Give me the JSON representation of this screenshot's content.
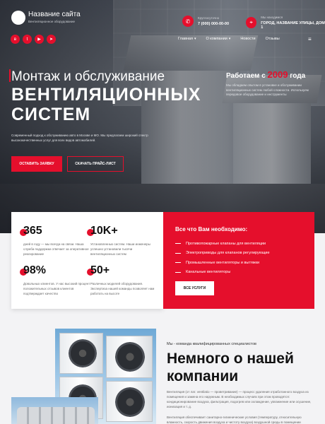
{
  "header": {
    "site_name": "Название сайта",
    "site_sub": "Вентиляционное оборудование",
    "phone_label": "Круглосуточно",
    "phone_value": "7 (000) 000-00-00",
    "address_label": "Мы находимся",
    "address_value": "ГОРОД, НАЗВАНИЕ УЛИЦЫ, ДОМ 1",
    "socials": [
      "vk-icon",
      "twitter-icon",
      "youtube-icon",
      "telegram-icon"
    ]
  },
  "nav": {
    "items": [
      {
        "label": "Главная",
        "has_dropdown": true
      },
      {
        "label": "О компании",
        "has_dropdown": true
      },
      {
        "label": "Новости",
        "has_dropdown": false
      },
      {
        "label": "Отзывы",
        "has_dropdown": false
      }
    ]
  },
  "hero": {
    "line1": "Монтаж и обслуживание",
    "line2a": "ВЕНТИЛЯЦИОННЫХ",
    "line2b": "СИСТЕМ",
    "desc": "Современный подход к обслуживанию авто в Москве и МО. Мы предлагаем широкий спектр высококачественных услуг для всех видов автомобилей.",
    "btn_primary": "ОСТАВИТЬ ЗАЯВКУ",
    "btn_secondary": "СКАЧАТЬ ПРАЙС-ЛИСТ",
    "work_prefix": "Работаем с",
    "work_year": "2009",
    "work_suffix": "года",
    "work_desc": "Мы обладаем опытом в установке и обслуживании вентиляционных систем любой сложности. Используем передовое оборудование и инструменты"
  },
  "stats": [
    {
      "num": "365",
      "desc": "дней в году — мы всегда на связи. Наша служба поддержки отвечает за оперативное реагирование"
    },
    {
      "num": "10K+",
      "desc": "Установленных систем. Наши инженеры успешно установили тысячи вентиляционных систем"
    },
    {
      "num": "98%",
      "desc": "Довольных клиентов. У нас высокий процент положительных отзывов клиентов подтверждает качество"
    },
    {
      "num": "50+",
      "desc": "Различных моделей оборудования. Экспертиза нашей команды позволяет нам работать на высоте"
    }
  ],
  "need": {
    "title": "Все что Вам необходимо:",
    "items": [
      "Противопожарные клапаны для вентиляции",
      "Электроприводы для клапанов регулирующие",
      "Промышленные вентиляторы и вытяжки",
      "Канальные вентиляторы"
    ],
    "button": "ВСЕ УСЛУГИ"
  },
  "about": {
    "tag": "Мы - команда квалифицированных специалистов",
    "title": "Немного о нашей компании",
    "p1": "Вентиляция (от лат. ventilatio — проветривание) — процесс удаления отработанного воздуха из помещения и замена его наружным. В необходимых случаях при этом проводятся: кондиционирование воздуха, фильтрация, подогрев или охлаждение, увлажнение или осушение, ионизация и т. д.",
    "p2": "Вентиляция обеспечивает санитарно-гигиенические условия (температуру, относительную влажность, скорость движения воздуха и чистоту воздуха) воздушной среды в помещении"
  }
}
